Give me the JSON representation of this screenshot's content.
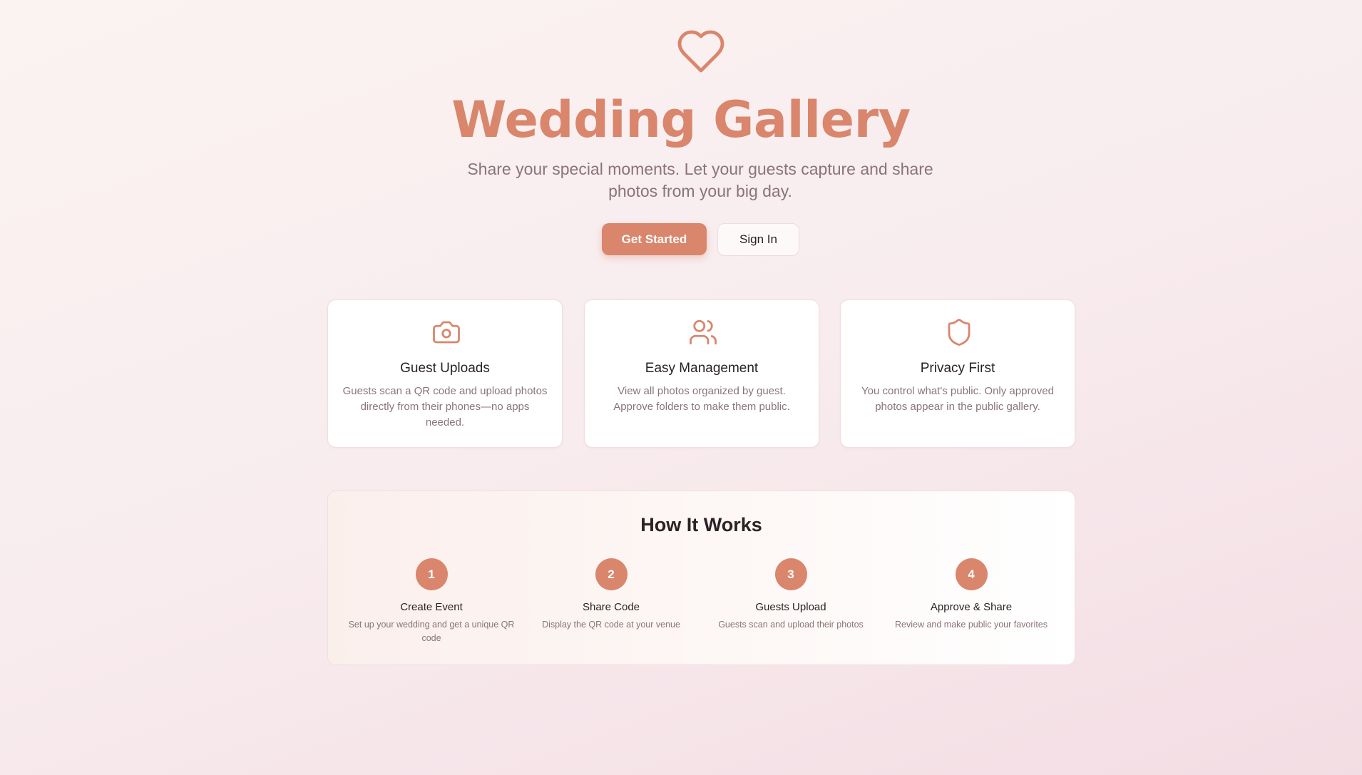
{
  "colors": {
    "accent": "#d9866d",
    "text_dark": "#2a2224",
    "text_muted": "#8a7479",
    "background": "#f8ecee"
  },
  "hero": {
    "icon": "heart-icon",
    "title": "Wedding Gallery",
    "subtitle": "Share your special moments. Let your guests capture and share photos from your big day.",
    "primary_button": "Get Started",
    "secondary_button": "Sign In"
  },
  "features": [
    {
      "icon": "camera-icon",
      "title": "Guest Uploads",
      "description": "Guests scan a QR code and upload photos directly from their phones—no apps needed."
    },
    {
      "icon": "users-icon",
      "title": "Easy Management",
      "description": "View all photos organized by guest. Approve folders to make them public."
    },
    {
      "icon": "shield-icon",
      "title": "Privacy First",
      "description": "You control what's public. Only approved photos appear in the public gallery."
    }
  ],
  "how_it_works": {
    "title": "How It Works",
    "steps": [
      {
        "number": "1",
        "title": "Create Event",
        "description": "Set up your wedding and get a unique QR code"
      },
      {
        "number": "2",
        "title": "Share Code",
        "description": "Display the QR code at your venue"
      },
      {
        "number": "3",
        "title": "Guests Upload",
        "description": "Guests scan and upload their photos"
      },
      {
        "number": "4",
        "title": "Approve & Share",
        "description": "Review and make public your favorites"
      }
    ]
  }
}
